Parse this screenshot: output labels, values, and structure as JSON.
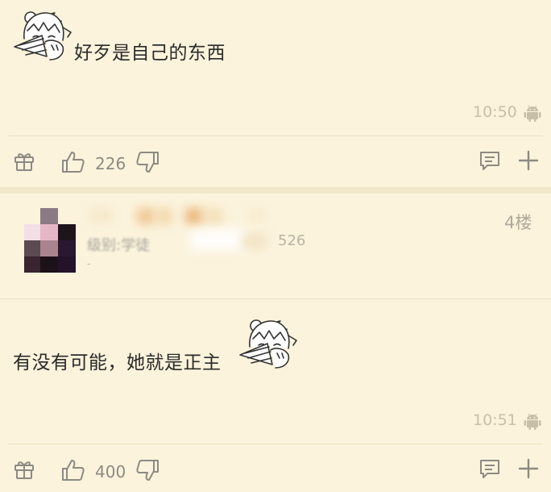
{
  "posts": [
    {
      "content": "好歹是自己的东西",
      "time": "10:50",
      "likes": "226"
    },
    {
      "floor": "4楼",
      "user_level_text": "级别:学徒",
      "user_count_text": "526",
      "user_sub_text": "-",
      "content": "有没有可能，她就是正主",
      "time": "10:51",
      "likes": "400"
    }
  ],
  "icons": {
    "gift": "gift-icon",
    "like": "thumbs-up-icon",
    "dislike": "thumbs-down-icon",
    "comment": "comment-icon",
    "add": "plus-icon",
    "device": "android-icon",
    "sticker": "anime-girl-sticker"
  },
  "colors": {
    "background": "#fbf3dc",
    "icon_gray": "#8d8a83",
    "time_gray": "#c8bfa9"
  }
}
